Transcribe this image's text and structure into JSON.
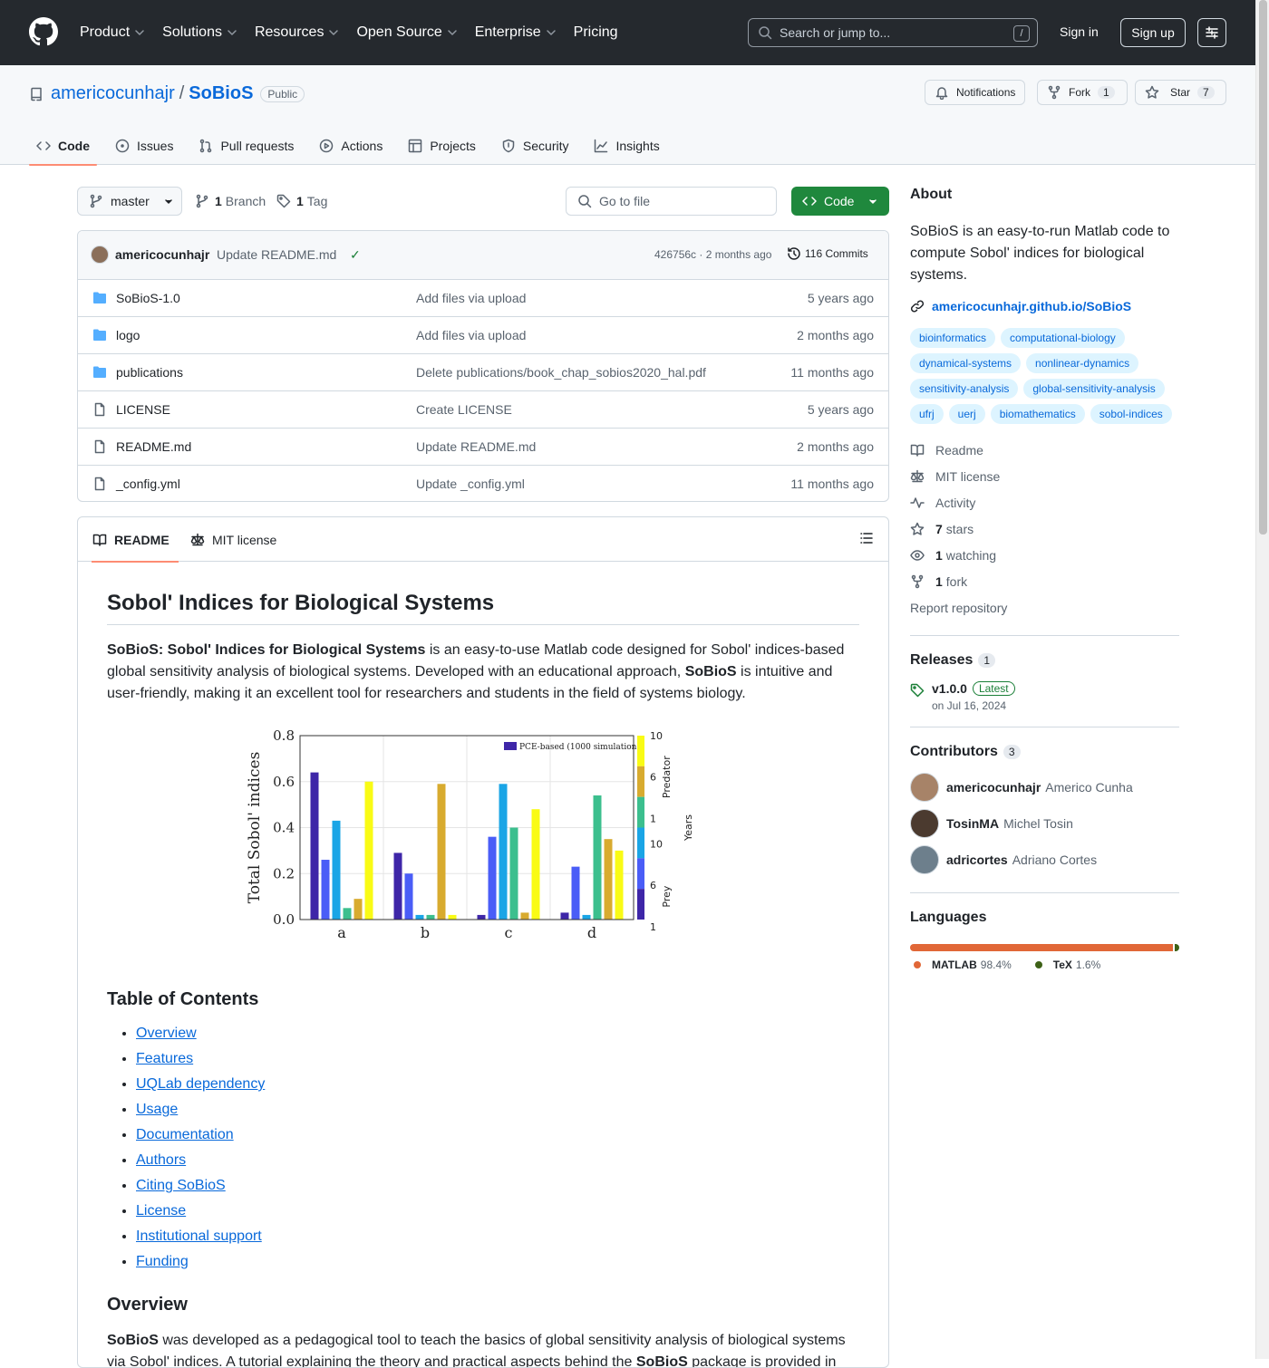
{
  "header": {
    "nav": [
      "Product",
      "Solutions",
      "Resources",
      "Open Source",
      "Enterprise",
      "Pricing"
    ],
    "search_placeholder": "Search or jump to...",
    "search_shortcut": "/",
    "sign_in": "Sign in",
    "sign_up": "Sign up"
  },
  "repo": {
    "owner": "americocunhajr",
    "separator": "/",
    "name": "SoBioS",
    "visibility": "Public",
    "notifications_label": "Notifications",
    "fork_label": "Fork",
    "fork_count": "1",
    "star_label": "Star",
    "star_count": "7",
    "tabs": [
      "Code",
      "Issues",
      "Pull requests",
      "Actions",
      "Projects",
      "Security",
      "Insights"
    ]
  },
  "toolbar": {
    "branch": "master",
    "branch_count": "1",
    "branch_label": "Branch",
    "tag_count": "1",
    "tag_label": "Tag",
    "goto_placeholder": "Go to file",
    "code_button": "Code"
  },
  "commit": {
    "user": "americocunhajr",
    "message": "Update README.md",
    "check": "✓",
    "sha_time": "426756c · 2 months ago",
    "commits": "116 Commits"
  },
  "files": [
    {
      "type": "dir",
      "name": "SoBioS-1.0",
      "message": "Add files via upload",
      "date": "5 years ago"
    },
    {
      "type": "dir",
      "name": "logo",
      "message": "Add files via upload",
      "date": "2 months ago"
    },
    {
      "type": "dir",
      "name": "publications",
      "message": "Delete publications/book_chap_sobios2020_hal.pdf",
      "date": "11 months ago"
    },
    {
      "type": "file",
      "name": "LICENSE",
      "message": "Create LICENSE",
      "date": "5 years ago"
    },
    {
      "type": "file",
      "name": "README.md",
      "message": "Update README.md",
      "date": "2 months ago"
    },
    {
      "type": "file",
      "name": "_config.yml",
      "message": "Update _config.yml",
      "date": "11 months ago"
    }
  ],
  "readme": {
    "tab_readme": "README",
    "tab_license": "MIT license",
    "title": "Sobol' Indices for Biological Systems",
    "intro_bold": "SoBioS: Sobol' Indices for Biological Systems",
    "intro_1": " is an easy-to-use Matlab code designed for Sobol' indices-based global sensitivity analysis of biological systems. Developed with an educational approach, ",
    "intro_bold2": "SoBioS",
    "intro_2": " is intuitive and user-friendly, making it an excellent tool for researchers and students in the field of systems biology.",
    "toc_title": "Table of Contents",
    "toc": [
      "Overview",
      "Features",
      "UQLab dependency",
      "Usage",
      "Documentation",
      "Authors",
      "Citing SoBioS",
      "License",
      "Institutional support",
      "Funding"
    ],
    "overview_title": "Overview",
    "overview_bold": "SoBioS",
    "overview_1": " was developed as a pedagogical tool to teach the basics of global sensitivity analysis of biological systems via Sobol' indices. A tutorial explaining the theory and practical aspects behind the ",
    "overview_bold2": "SoBioS",
    "overview_2": " package is provided in"
  },
  "chart_data": {
    "type": "bar",
    "categories": [
      "a",
      "b",
      "c",
      "d"
    ],
    "ylabel": "Total Sobol' indices",
    "ylim": [
      0,
      0.8
    ],
    "yticks": [
      "0.0",
      "0.2",
      "0.4",
      "0.6",
      "0.8"
    ],
    "legend": "PCE-based (1000 simulations)",
    "series_values": [
      [
        0.64,
        0.26,
        0.43,
        0.05,
        0.09,
        0.6
      ],
      [
        0.29,
        0.2,
        0.02,
        0.02,
        0.59,
        0.02
      ],
      [
        0.02,
        0.36,
        0.59,
        0.4,
        0.03,
        0.48
      ],
      [
        0.03,
        0.23,
        0.02,
        0.54,
        0.35,
        0.3
      ]
    ],
    "bar_colors": [
      "#3e26a8",
      "#4a5df7",
      "#1aa5e6",
      "#3cbf8e",
      "#d8ab2f",
      "#f9fb15"
    ],
    "colorbar_labels": {
      "predator": "Predator",
      "prey": "Prey",
      "years": "Years",
      "ticks_top": [
        "10",
        "6",
        "1"
      ],
      "ticks_bottom": [
        "10",
        "6",
        "1"
      ]
    }
  },
  "about": {
    "title": "About",
    "description": "SoBioS is an easy-to-run Matlab code to compute Sobol' indices for biological systems.",
    "website": "americocunhajr.github.io/SoBioS",
    "topics": [
      "bioinformatics",
      "computational-biology",
      "dynamical-systems",
      "nonlinear-dynamics",
      "sensitivity-analysis",
      "global-sensitivity-analysis",
      "ufrj",
      "uerj",
      "biomathematics",
      "sobol-indices"
    ],
    "readme": "Readme",
    "license": "MIT license",
    "activity": "Activity",
    "stars_count": "7",
    "stars_label": "stars",
    "watching_count": "1",
    "watching_label": "watching",
    "fork_count": "1",
    "fork_label": "fork",
    "report": "Report repository"
  },
  "releases": {
    "title": "Releases",
    "count": "1",
    "tag": "v1.0.0",
    "latest": "Latest",
    "date": "on Jul 16, 2024"
  },
  "contributors": {
    "title": "Contributors",
    "count": "3",
    "list": [
      {
        "login": "americocunhajr",
        "name": "Americo Cunha"
      },
      {
        "login": "TosinMA",
        "name": "Michel Tosin"
      },
      {
        "login": "adricortes",
        "name": "Adriano Cortes"
      }
    ]
  },
  "languages": {
    "title": "Languages",
    "list": [
      {
        "name": "MATLAB",
        "percent": "98.4%",
        "value": 98.4,
        "color": "#e16737"
      },
      {
        "name": "TeX",
        "percent": "1.6%",
        "value": 1.6,
        "color": "#3d6117"
      }
    ]
  }
}
